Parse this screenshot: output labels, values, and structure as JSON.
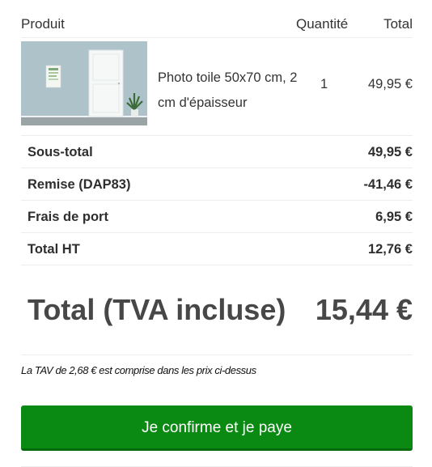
{
  "cart": {
    "headers": {
      "product": "Produit",
      "quantity": "Quantité",
      "total": "Total"
    },
    "item": {
      "name": "Photo toile 50x70 cm, 2 cm d'épaisseur",
      "quantity": "1",
      "total": "49,95 €",
      "thumbnail": "framed-photo-on-wall-image"
    }
  },
  "summary": {
    "subtotal": {
      "label": "Sous-total",
      "value": "49,95 €"
    },
    "discount": {
      "label": "Remise (DAP83)",
      "value": "-41,46 €"
    },
    "shipping": {
      "label": "Frais de port",
      "value": "6,95 €"
    },
    "total_ht": {
      "label": "Total HT",
      "value": "12,76 €"
    }
  },
  "grand_total": {
    "label": "Total (TVA incluse)",
    "value": "15,44 €"
  },
  "tax_note": "La TAV de 2,68  € est comprise dans les prix ci-dessus",
  "confirm_button": {
    "label": "Je confirme et je paye",
    "color": "#0a8a12"
  }
}
